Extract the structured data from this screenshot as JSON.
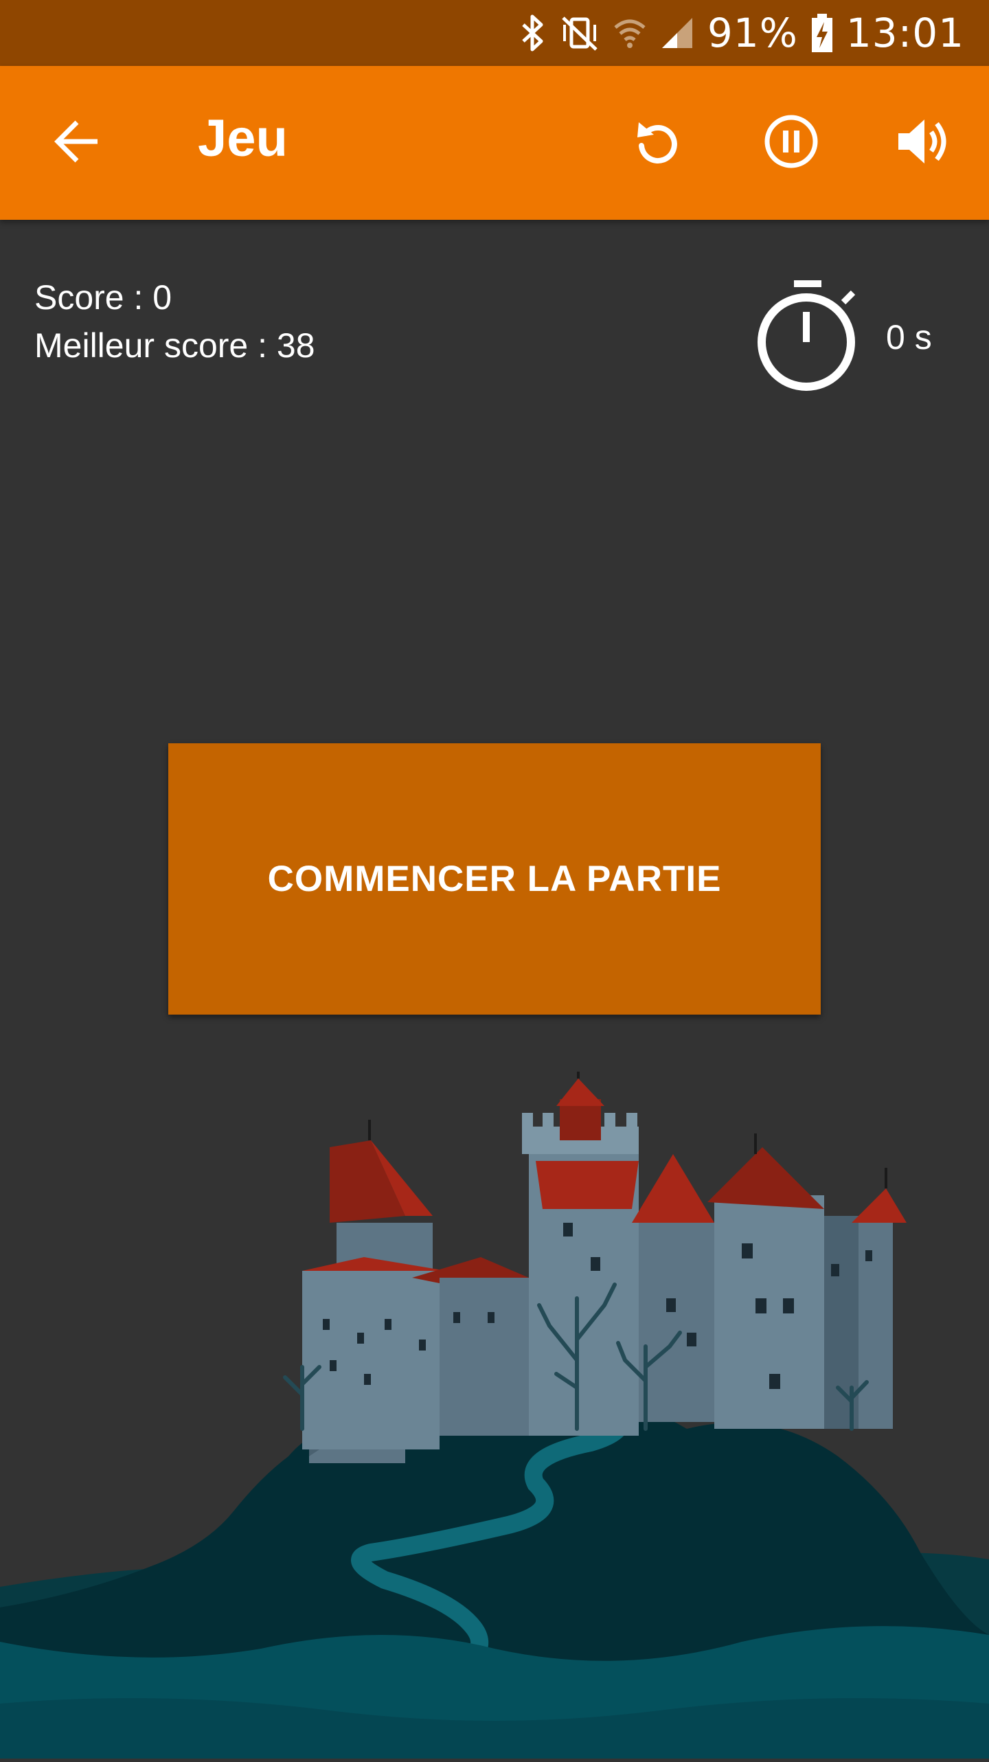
{
  "status_bar": {
    "battery": "91%",
    "time": "13:01",
    "icons": [
      "bluetooth-icon",
      "vibrate-icon",
      "wifi-icon",
      "signal-icon",
      "battery-charging-icon"
    ]
  },
  "app_bar": {
    "title": "Jeu",
    "back_icon": "arrow-back-icon",
    "actions": [
      "replay-icon",
      "pause-icon",
      "volume-icon"
    ]
  },
  "game": {
    "score": "Score : 0",
    "best_score": "Meilleur score : 38",
    "timer_icon": "stopwatch-icon",
    "timer": "0 s",
    "start_button": "COMMENCER LA PARTIE"
  },
  "illustration": {
    "name": "castle-on-hill"
  },
  "colors": {
    "status_bar": "#8f4600",
    "app_bar": "#ef7700",
    "background": "#333333",
    "button": "#c46400"
  }
}
